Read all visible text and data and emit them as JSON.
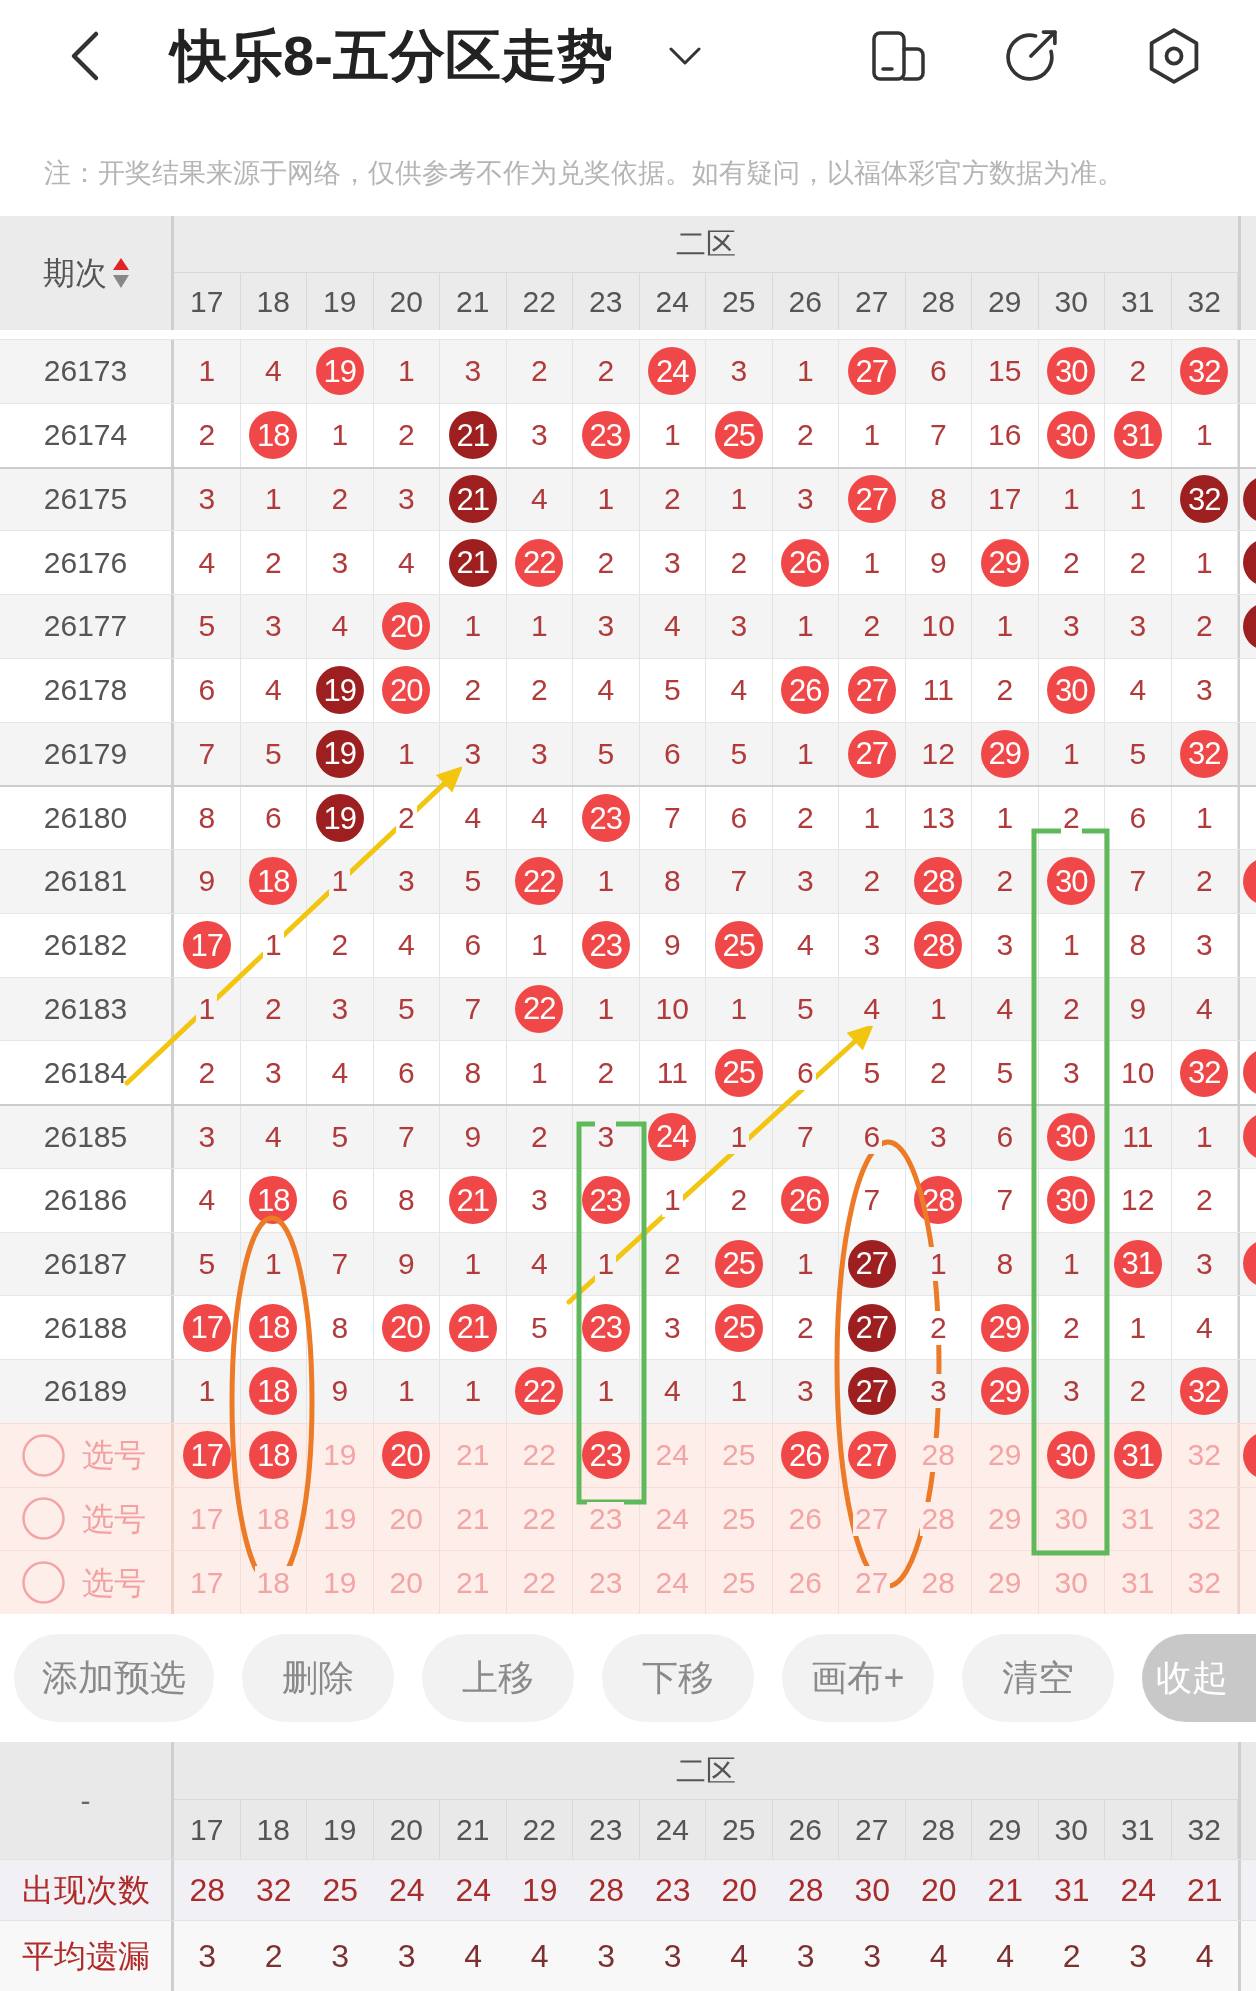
{
  "header": {
    "title": "快乐8-五分区走势"
  },
  "notice": "注：开奖结果来源于网络，仅供参考不作为兑奖依据。如有疑问，以福体彩官方数据为准。",
  "trend_table": {
    "period_heading": "期次",
    "sort_ascending": true,
    "zone_label": "二区",
    "columns": [
      "17",
      "18",
      "19",
      "20",
      "21",
      "22",
      "23",
      "24",
      "25",
      "26",
      "27",
      "28",
      "29",
      "30",
      "31",
      "32"
    ],
    "rows": [
      {
        "period": "26173",
        "cells": [
          {
            "value": "1",
            "kind": "miss"
          },
          {
            "value": "4",
            "kind": "miss"
          },
          {
            "value": "19",
            "kind": "hit"
          },
          {
            "value": "1",
            "kind": "miss"
          },
          {
            "value": "3",
            "kind": "miss"
          },
          {
            "value": "2",
            "kind": "miss"
          },
          {
            "value": "2",
            "kind": "miss"
          },
          {
            "value": "24",
            "kind": "hit"
          },
          {
            "value": "3",
            "kind": "miss"
          },
          {
            "value": "1",
            "kind": "miss"
          },
          {
            "value": "27",
            "kind": "hit"
          },
          {
            "value": "6",
            "kind": "miss"
          },
          {
            "value": "15",
            "kind": "miss"
          },
          {
            "value": "30",
            "kind": "hit"
          },
          {
            "value": "2",
            "kind": "miss"
          },
          {
            "value": "32",
            "kind": "hit"
          }
        ]
      },
      {
        "period": "26174",
        "cells": [
          {
            "value": "2",
            "kind": "miss"
          },
          {
            "value": "18",
            "kind": "hit"
          },
          {
            "value": "1",
            "kind": "miss"
          },
          {
            "value": "2",
            "kind": "miss"
          },
          {
            "value": "21",
            "kind": "repeat"
          },
          {
            "value": "3",
            "kind": "miss"
          },
          {
            "value": "23",
            "kind": "hit"
          },
          {
            "value": "1",
            "kind": "miss"
          },
          {
            "value": "25",
            "kind": "hit"
          },
          {
            "value": "2",
            "kind": "miss"
          },
          {
            "value": "1",
            "kind": "miss"
          },
          {
            "value": "7",
            "kind": "miss"
          },
          {
            "value": "16",
            "kind": "miss"
          },
          {
            "value": "30",
            "kind": "hit"
          },
          {
            "value": "31",
            "kind": "hit"
          },
          {
            "value": "1",
            "kind": "miss"
          }
        ]
      },
      {
        "period": "26175",
        "next_cell": {
          "kind": "repeat"
        },
        "cells": [
          {
            "value": "3",
            "kind": "miss"
          },
          {
            "value": "1",
            "kind": "miss"
          },
          {
            "value": "2",
            "kind": "miss"
          },
          {
            "value": "3",
            "kind": "miss"
          },
          {
            "value": "21",
            "kind": "repeat"
          },
          {
            "value": "4",
            "kind": "miss"
          },
          {
            "value": "1",
            "kind": "miss"
          },
          {
            "value": "2",
            "kind": "miss"
          },
          {
            "value": "1",
            "kind": "miss"
          },
          {
            "value": "3",
            "kind": "miss"
          },
          {
            "value": "27",
            "kind": "hit"
          },
          {
            "value": "8",
            "kind": "miss"
          },
          {
            "value": "17",
            "kind": "miss"
          },
          {
            "value": "1",
            "kind": "miss"
          },
          {
            "value": "1",
            "kind": "miss"
          },
          {
            "value": "32",
            "kind": "repeat"
          }
        ]
      },
      {
        "period": "26176",
        "next_cell": {
          "kind": "repeat"
        },
        "cells": [
          {
            "value": "4",
            "kind": "miss"
          },
          {
            "value": "2",
            "kind": "miss"
          },
          {
            "value": "3",
            "kind": "miss"
          },
          {
            "value": "4",
            "kind": "miss"
          },
          {
            "value": "21",
            "kind": "repeat"
          },
          {
            "value": "22",
            "kind": "hit"
          },
          {
            "value": "2",
            "kind": "miss"
          },
          {
            "value": "3",
            "kind": "miss"
          },
          {
            "value": "2",
            "kind": "miss"
          },
          {
            "value": "26",
            "kind": "hit"
          },
          {
            "value": "1",
            "kind": "miss"
          },
          {
            "value": "9",
            "kind": "miss"
          },
          {
            "value": "29",
            "kind": "hit"
          },
          {
            "value": "2",
            "kind": "miss"
          },
          {
            "value": "2",
            "kind": "miss"
          },
          {
            "value": "1",
            "kind": "miss"
          }
        ]
      },
      {
        "period": "26177",
        "next_cell": {
          "kind": "repeat"
        },
        "cells": [
          {
            "value": "5",
            "kind": "miss"
          },
          {
            "value": "3",
            "kind": "miss"
          },
          {
            "value": "4",
            "kind": "miss"
          },
          {
            "value": "20",
            "kind": "hit"
          },
          {
            "value": "1",
            "kind": "miss"
          },
          {
            "value": "1",
            "kind": "miss"
          },
          {
            "value": "3",
            "kind": "miss"
          },
          {
            "value": "4",
            "kind": "miss"
          },
          {
            "value": "3",
            "kind": "miss"
          },
          {
            "value": "1",
            "kind": "miss"
          },
          {
            "value": "2",
            "kind": "miss"
          },
          {
            "value": "10",
            "kind": "miss"
          },
          {
            "value": "1",
            "kind": "miss"
          },
          {
            "value": "3",
            "kind": "miss"
          },
          {
            "value": "3",
            "kind": "miss"
          },
          {
            "value": "2",
            "kind": "miss"
          }
        ]
      },
      {
        "period": "26178",
        "cells": [
          {
            "value": "6",
            "kind": "miss"
          },
          {
            "value": "4",
            "kind": "miss"
          },
          {
            "value": "19",
            "kind": "repeat"
          },
          {
            "value": "20",
            "kind": "hit"
          },
          {
            "value": "2",
            "kind": "miss"
          },
          {
            "value": "2",
            "kind": "miss"
          },
          {
            "value": "4",
            "kind": "miss"
          },
          {
            "value": "5",
            "kind": "miss"
          },
          {
            "value": "4",
            "kind": "miss"
          },
          {
            "value": "26",
            "kind": "hit"
          },
          {
            "value": "27",
            "kind": "hit"
          },
          {
            "value": "11",
            "kind": "miss"
          },
          {
            "value": "2",
            "kind": "miss"
          },
          {
            "value": "30",
            "kind": "hit"
          },
          {
            "value": "4",
            "kind": "miss"
          },
          {
            "value": "3",
            "kind": "miss"
          }
        ]
      },
      {
        "period": "26179",
        "cells": [
          {
            "value": "7",
            "kind": "miss"
          },
          {
            "value": "5",
            "kind": "miss"
          },
          {
            "value": "19",
            "kind": "repeat"
          },
          {
            "value": "1",
            "kind": "miss"
          },
          {
            "value": "3",
            "kind": "miss"
          },
          {
            "value": "3",
            "kind": "miss"
          },
          {
            "value": "5",
            "kind": "miss"
          },
          {
            "value": "6",
            "kind": "miss"
          },
          {
            "value": "5",
            "kind": "miss"
          },
          {
            "value": "1",
            "kind": "miss"
          },
          {
            "value": "27",
            "kind": "hit"
          },
          {
            "value": "12",
            "kind": "miss"
          },
          {
            "value": "29",
            "kind": "hit"
          },
          {
            "value": "1",
            "kind": "miss"
          },
          {
            "value": "5",
            "kind": "miss"
          },
          {
            "value": "32",
            "kind": "hit"
          }
        ]
      },
      {
        "period": "26180",
        "cells": [
          {
            "value": "8",
            "kind": "miss"
          },
          {
            "value": "6",
            "kind": "miss"
          },
          {
            "value": "19",
            "kind": "repeat"
          },
          {
            "value": "2",
            "kind": "miss"
          },
          {
            "value": "4",
            "kind": "miss"
          },
          {
            "value": "4",
            "kind": "miss"
          },
          {
            "value": "23",
            "kind": "hit"
          },
          {
            "value": "7",
            "kind": "miss"
          },
          {
            "value": "6",
            "kind": "miss"
          },
          {
            "value": "2",
            "kind": "miss"
          },
          {
            "value": "1",
            "kind": "miss"
          },
          {
            "value": "13",
            "kind": "miss"
          },
          {
            "value": "1",
            "kind": "miss"
          },
          {
            "value": "2",
            "kind": "miss"
          },
          {
            "value": "6",
            "kind": "miss"
          },
          {
            "value": "1",
            "kind": "miss"
          }
        ]
      },
      {
        "period": "26181",
        "next_cell": {
          "kind": "hit"
        },
        "cells": [
          {
            "value": "9",
            "kind": "miss"
          },
          {
            "value": "18",
            "kind": "hit"
          },
          {
            "value": "1",
            "kind": "miss"
          },
          {
            "value": "3",
            "kind": "miss"
          },
          {
            "value": "5",
            "kind": "miss"
          },
          {
            "value": "22",
            "kind": "hit"
          },
          {
            "value": "1",
            "kind": "miss"
          },
          {
            "value": "8",
            "kind": "miss"
          },
          {
            "value": "7",
            "kind": "miss"
          },
          {
            "value": "3",
            "kind": "miss"
          },
          {
            "value": "2",
            "kind": "miss"
          },
          {
            "value": "28",
            "kind": "hit"
          },
          {
            "value": "2",
            "kind": "miss"
          },
          {
            "value": "30",
            "kind": "hit"
          },
          {
            "value": "7",
            "kind": "miss"
          },
          {
            "value": "2",
            "kind": "miss"
          }
        ]
      },
      {
        "period": "26182",
        "cells": [
          {
            "value": "17",
            "kind": "hit"
          },
          {
            "value": "1",
            "kind": "miss"
          },
          {
            "value": "2",
            "kind": "miss"
          },
          {
            "value": "4",
            "kind": "miss"
          },
          {
            "value": "6",
            "kind": "miss"
          },
          {
            "value": "1",
            "kind": "miss"
          },
          {
            "value": "23",
            "kind": "hit"
          },
          {
            "value": "9",
            "kind": "miss"
          },
          {
            "value": "25",
            "kind": "hit"
          },
          {
            "value": "4",
            "kind": "miss"
          },
          {
            "value": "3",
            "kind": "miss"
          },
          {
            "value": "28",
            "kind": "hit"
          },
          {
            "value": "3",
            "kind": "miss"
          },
          {
            "value": "1",
            "kind": "miss"
          },
          {
            "value": "8",
            "kind": "miss"
          },
          {
            "value": "3",
            "kind": "miss"
          }
        ]
      },
      {
        "period": "26183",
        "cells": [
          {
            "value": "1",
            "kind": "miss"
          },
          {
            "value": "2",
            "kind": "miss"
          },
          {
            "value": "3",
            "kind": "miss"
          },
          {
            "value": "5",
            "kind": "miss"
          },
          {
            "value": "7",
            "kind": "miss"
          },
          {
            "value": "22",
            "kind": "hit"
          },
          {
            "value": "1",
            "kind": "miss"
          },
          {
            "value": "10",
            "kind": "miss"
          },
          {
            "value": "1",
            "kind": "miss"
          },
          {
            "value": "5",
            "kind": "miss"
          },
          {
            "value": "4",
            "kind": "miss"
          },
          {
            "value": "1",
            "kind": "miss"
          },
          {
            "value": "4",
            "kind": "miss"
          },
          {
            "value": "2",
            "kind": "miss"
          },
          {
            "value": "9",
            "kind": "miss"
          },
          {
            "value": "4",
            "kind": "miss"
          }
        ]
      },
      {
        "period": "26184",
        "next_cell": {
          "kind": "hit"
        },
        "cells": [
          {
            "value": "2",
            "kind": "miss"
          },
          {
            "value": "3",
            "kind": "miss"
          },
          {
            "value": "4",
            "kind": "miss"
          },
          {
            "value": "6",
            "kind": "miss"
          },
          {
            "value": "8",
            "kind": "miss"
          },
          {
            "value": "1",
            "kind": "miss"
          },
          {
            "value": "2",
            "kind": "miss"
          },
          {
            "value": "11",
            "kind": "miss"
          },
          {
            "value": "25",
            "kind": "hit"
          },
          {
            "value": "6",
            "kind": "miss"
          },
          {
            "value": "5",
            "kind": "miss"
          },
          {
            "value": "2",
            "kind": "miss"
          },
          {
            "value": "5",
            "kind": "miss"
          },
          {
            "value": "3",
            "kind": "miss"
          },
          {
            "value": "10",
            "kind": "miss"
          },
          {
            "value": "32",
            "kind": "hit"
          }
        ]
      },
      {
        "period": "26185",
        "next_cell": {
          "kind": "hit"
        },
        "cells": [
          {
            "value": "3",
            "kind": "miss"
          },
          {
            "value": "4",
            "kind": "miss"
          },
          {
            "value": "5",
            "kind": "miss"
          },
          {
            "value": "7",
            "kind": "miss"
          },
          {
            "value": "9",
            "kind": "miss"
          },
          {
            "value": "2",
            "kind": "miss"
          },
          {
            "value": "3",
            "kind": "miss"
          },
          {
            "value": "24",
            "kind": "hit"
          },
          {
            "value": "1",
            "kind": "miss"
          },
          {
            "value": "7",
            "kind": "miss"
          },
          {
            "value": "6",
            "kind": "miss"
          },
          {
            "value": "3",
            "kind": "miss"
          },
          {
            "value": "6",
            "kind": "miss"
          },
          {
            "value": "30",
            "kind": "hit"
          },
          {
            "value": "11",
            "kind": "miss"
          },
          {
            "value": "1",
            "kind": "miss"
          }
        ]
      },
      {
        "period": "26186",
        "cells": [
          {
            "value": "4",
            "kind": "miss"
          },
          {
            "value": "18",
            "kind": "hit"
          },
          {
            "value": "6",
            "kind": "miss"
          },
          {
            "value": "8",
            "kind": "miss"
          },
          {
            "value": "21",
            "kind": "hit"
          },
          {
            "value": "3",
            "kind": "miss"
          },
          {
            "value": "23",
            "kind": "hit"
          },
          {
            "value": "1",
            "kind": "miss"
          },
          {
            "value": "2",
            "kind": "miss"
          },
          {
            "value": "26",
            "kind": "hit"
          },
          {
            "value": "7",
            "kind": "miss"
          },
          {
            "value": "28",
            "kind": "hit"
          },
          {
            "value": "7",
            "kind": "miss"
          },
          {
            "value": "30",
            "kind": "hit"
          },
          {
            "value": "12",
            "kind": "miss"
          },
          {
            "value": "2",
            "kind": "miss"
          }
        ]
      },
      {
        "period": "26187",
        "next_cell": {
          "kind": "hit"
        },
        "cells": [
          {
            "value": "5",
            "kind": "miss"
          },
          {
            "value": "1",
            "kind": "miss"
          },
          {
            "value": "7",
            "kind": "miss"
          },
          {
            "value": "9",
            "kind": "miss"
          },
          {
            "value": "1",
            "kind": "miss"
          },
          {
            "value": "4",
            "kind": "miss"
          },
          {
            "value": "1",
            "kind": "miss"
          },
          {
            "value": "2",
            "kind": "miss"
          },
          {
            "value": "25",
            "kind": "hit"
          },
          {
            "value": "1",
            "kind": "miss"
          },
          {
            "value": "27",
            "kind": "repeat"
          },
          {
            "value": "1",
            "kind": "miss"
          },
          {
            "value": "8",
            "kind": "miss"
          },
          {
            "value": "1",
            "kind": "miss"
          },
          {
            "value": "31",
            "kind": "hit"
          },
          {
            "value": "3",
            "kind": "miss"
          }
        ]
      },
      {
        "period": "26188",
        "cells": [
          {
            "value": "17",
            "kind": "hit"
          },
          {
            "value": "18",
            "kind": "hit"
          },
          {
            "value": "8",
            "kind": "miss"
          },
          {
            "value": "20",
            "kind": "hit"
          },
          {
            "value": "21",
            "kind": "hit"
          },
          {
            "value": "5",
            "kind": "miss"
          },
          {
            "value": "23",
            "kind": "hit"
          },
          {
            "value": "3",
            "kind": "miss"
          },
          {
            "value": "25",
            "kind": "hit"
          },
          {
            "value": "2",
            "kind": "miss"
          },
          {
            "value": "27",
            "kind": "repeat"
          },
          {
            "value": "2",
            "kind": "miss"
          },
          {
            "value": "29",
            "kind": "hit"
          },
          {
            "value": "2",
            "kind": "miss"
          },
          {
            "value": "1",
            "kind": "miss"
          },
          {
            "value": "4",
            "kind": "miss"
          }
        ]
      },
      {
        "period": "26189",
        "cells": [
          {
            "value": "1",
            "kind": "miss"
          },
          {
            "value": "18",
            "kind": "hit"
          },
          {
            "value": "9",
            "kind": "miss"
          },
          {
            "value": "1",
            "kind": "miss"
          },
          {
            "value": "1",
            "kind": "miss"
          },
          {
            "value": "22",
            "kind": "hit"
          },
          {
            "value": "1",
            "kind": "miss"
          },
          {
            "value": "4",
            "kind": "miss"
          },
          {
            "value": "1",
            "kind": "miss"
          },
          {
            "value": "3",
            "kind": "miss"
          },
          {
            "value": "27",
            "kind": "repeat"
          },
          {
            "value": "3",
            "kind": "miss"
          },
          {
            "value": "29",
            "kind": "hit"
          },
          {
            "value": "3",
            "kind": "miss"
          },
          {
            "value": "2",
            "kind": "miss"
          },
          {
            "value": "32",
            "kind": "hit"
          }
        ]
      }
    ],
    "pick_rows": [
      {
        "label": "选号",
        "selected": false,
        "next_cell": {
          "kind": "hit"
        },
        "cells": [
          {
            "value": "17",
            "kind": "hit"
          },
          {
            "value": "18",
            "kind": "hit"
          },
          {
            "value": "19",
            "kind": "miss"
          },
          {
            "value": "20",
            "kind": "hit"
          },
          {
            "value": "21",
            "kind": "miss"
          },
          {
            "value": "22",
            "kind": "miss"
          },
          {
            "value": "23",
            "kind": "hit"
          },
          {
            "value": "24",
            "kind": "miss"
          },
          {
            "value": "25",
            "kind": "miss"
          },
          {
            "value": "26",
            "kind": "hit"
          },
          {
            "value": "27",
            "kind": "hit"
          },
          {
            "value": "28",
            "kind": "miss"
          },
          {
            "value": "29",
            "kind": "miss"
          },
          {
            "value": "30",
            "kind": "hit"
          },
          {
            "value": "31",
            "kind": "hit"
          },
          {
            "value": "32",
            "kind": "miss"
          }
        ]
      },
      {
        "label": "选号",
        "selected": false,
        "cells": [
          {
            "value": "17",
            "kind": "miss"
          },
          {
            "value": "18",
            "kind": "miss"
          },
          {
            "value": "19",
            "kind": "miss"
          },
          {
            "value": "20",
            "kind": "miss"
          },
          {
            "value": "21",
            "kind": "miss"
          },
          {
            "value": "22",
            "kind": "miss"
          },
          {
            "value": "23",
            "kind": "miss"
          },
          {
            "value": "24",
            "kind": "miss"
          },
          {
            "value": "25",
            "kind": "miss"
          },
          {
            "value": "26",
            "kind": "miss"
          },
          {
            "value": "27",
            "kind": "miss"
          },
          {
            "value": "28",
            "kind": "miss"
          },
          {
            "value": "29",
            "kind": "miss"
          },
          {
            "value": "30",
            "kind": "miss"
          },
          {
            "value": "31",
            "kind": "miss"
          },
          {
            "value": "32",
            "kind": "miss"
          }
        ]
      },
      {
        "label": "选号",
        "selected": false,
        "cells": [
          {
            "value": "17",
            "kind": "miss"
          },
          {
            "value": "18",
            "kind": "miss"
          },
          {
            "value": "19",
            "kind": "miss"
          },
          {
            "value": "20",
            "kind": "miss"
          },
          {
            "value": "21",
            "kind": "miss"
          },
          {
            "value": "22",
            "kind": "miss"
          },
          {
            "value": "23",
            "kind": "miss"
          },
          {
            "value": "24",
            "kind": "miss"
          },
          {
            "value": "25",
            "kind": "miss"
          },
          {
            "value": "26",
            "kind": "miss"
          },
          {
            "value": "27",
            "kind": "miss"
          },
          {
            "value": "28",
            "kind": "miss"
          },
          {
            "value": "29",
            "kind": "miss"
          },
          {
            "value": "30",
            "kind": "miss"
          },
          {
            "value": "31",
            "kind": "miss"
          },
          {
            "value": "32",
            "kind": "miss"
          }
        ]
      }
    ]
  },
  "annotations": [
    {
      "kind": "arrow"
    },
    {
      "kind": "arrow"
    },
    {
      "kind": "frame"
    },
    {
      "kind": "frame"
    },
    {
      "kind": "oval"
    },
    {
      "kind": "oval"
    }
  ],
  "buttons": [
    {
      "label": "添加预选",
      "kind": "action"
    },
    {
      "label": "删除",
      "kind": "action"
    },
    {
      "label": "上移",
      "kind": "action"
    },
    {
      "label": "下移",
      "kind": "action"
    },
    {
      "label": "画布+",
      "kind": "action"
    },
    {
      "label": "清空",
      "kind": "action"
    },
    {
      "label": "收起",
      "kind": "collapse"
    }
  ],
  "stats_table": {
    "corner_label": "-",
    "zone_label": "二区",
    "columns": [
      "17",
      "18",
      "19",
      "20",
      "21",
      "22",
      "23",
      "24",
      "25",
      "26",
      "27",
      "28",
      "29",
      "30",
      "31",
      "32"
    ],
    "rows": [
      {
        "label": "出现次数",
        "values": [
          "28",
          "32",
          "25",
          "24",
          "24",
          "19",
          "28",
          "23",
          "20",
          "28",
          "30",
          "20",
          "21",
          "31",
          "24",
          "21"
        ]
      },
      {
        "label": "平均遗漏",
        "values": [
          "3",
          "2",
          "3",
          "3",
          "4",
          "4",
          "3",
          "3",
          "4",
          "3",
          "3",
          "4",
          "4",
          "2",
          "3",
          "4"
        ]
      }
    ]
  }
}
